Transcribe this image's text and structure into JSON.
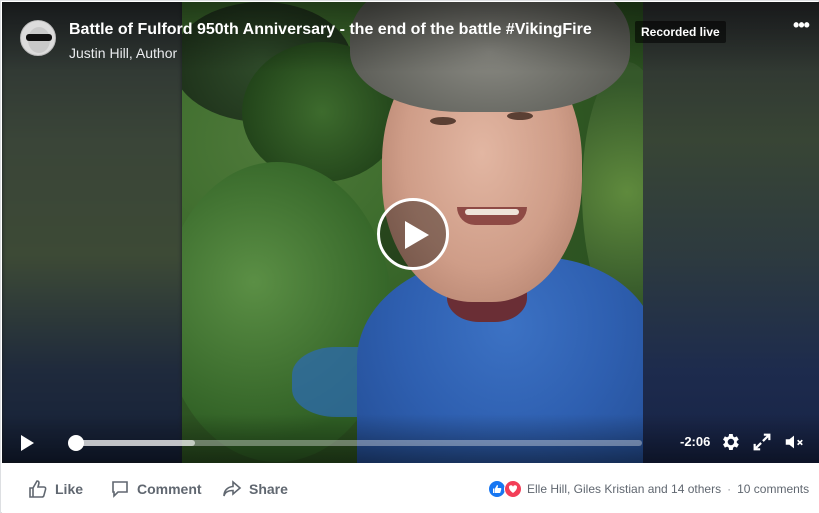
{
  "video": {
    "title": "Battle of Fulford 950th Anniversary - the end of the battle #VikingFire",
    "author": "Justin Hill, Author",
    "badge": "Recorded live",
    "time_remaining": "-2:06",
    "progress": 0.0,
    "buffered": 0.21
  },
  "actions": {
    "like": "Like",
    "comment": "Comment",
    "share": "Share"
  },
  "reactions": {
    "names": "Elle Hill, Giles Kristian and 14 others",
    "separator": "·",
    "comments": "10 comments"
  },
  "icons": [
    "more-options-icon",
    "play-icon",
    "settings-icon",
    "fullscreen-icon",
    "mute-icon",
    "like-icon",
    "comment-icon",
    "share-icon",
    "like-reaction-icon",
    "love-reaction-icon"
  ],
  "colors": {
    "accent": "#1877f2",
    "love": "#f33e58",
    "action_text": "#606770"
  }
}
